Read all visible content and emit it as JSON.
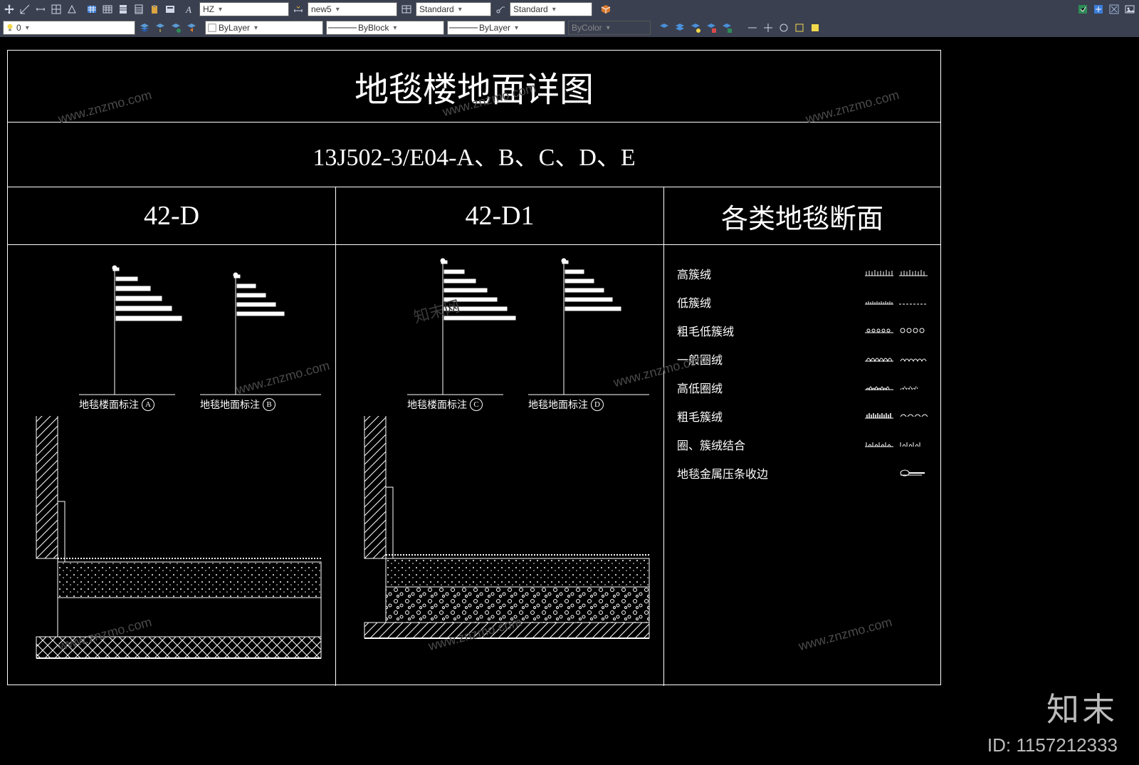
{
  "toolbar1": {
    "text_style": "HZ",
    "dim_style": "new5",
    "table_style": "Standard",
    "mleader_style": "Standard"
  },
  "toolbar2": {
    "layer": "0",
    "color": "ByLayer",
    "linetype": "ByBlock",
    "lineweight": "ByLayer",
    "plotstyle": "ByColor"
  },
  "drawing": {
    "title": "地毯楼地面详图",
    "subtitle": "13J502-3/E04-A、B、C、D、E",
    "cols": {
      "a": {
        "head": "42-D",
        "note1": "地毯楼面标注",
        "tag1": "A",
        "note2": "地毯地面标注",
        "tag2": "B"
      },
      "b": {
        "head": "42-D1",
        "note1": "地毯楼面标注",
        "tag1": "C",
        "note2": "地毯地面标注",
        "tag2": "D"
      },
      "c": {
        "head": "各类地毯断面"
      }
    },
    "carpets": [
      {
        "name": "高簇绒"
      },
      {
        "name": "低簇绒"
      },
      {
        "name": "粗毛低簇绒"
      },
      {
        "name": "一般圈绒"
      },
      {
        "name": "高低圈绒"
      },
      {
        "name": "粗毛簇绒"
      },
      {
        "name": "圈、簇绒结合"
      },
      {
        "name": "地毯金属压条收边"
      }
    ]
  },
  "watermark": {
    "brand": "知末",
    "id_label": "ID: 1157212333",
    "url": "www.znzmo.com"
  }
}
